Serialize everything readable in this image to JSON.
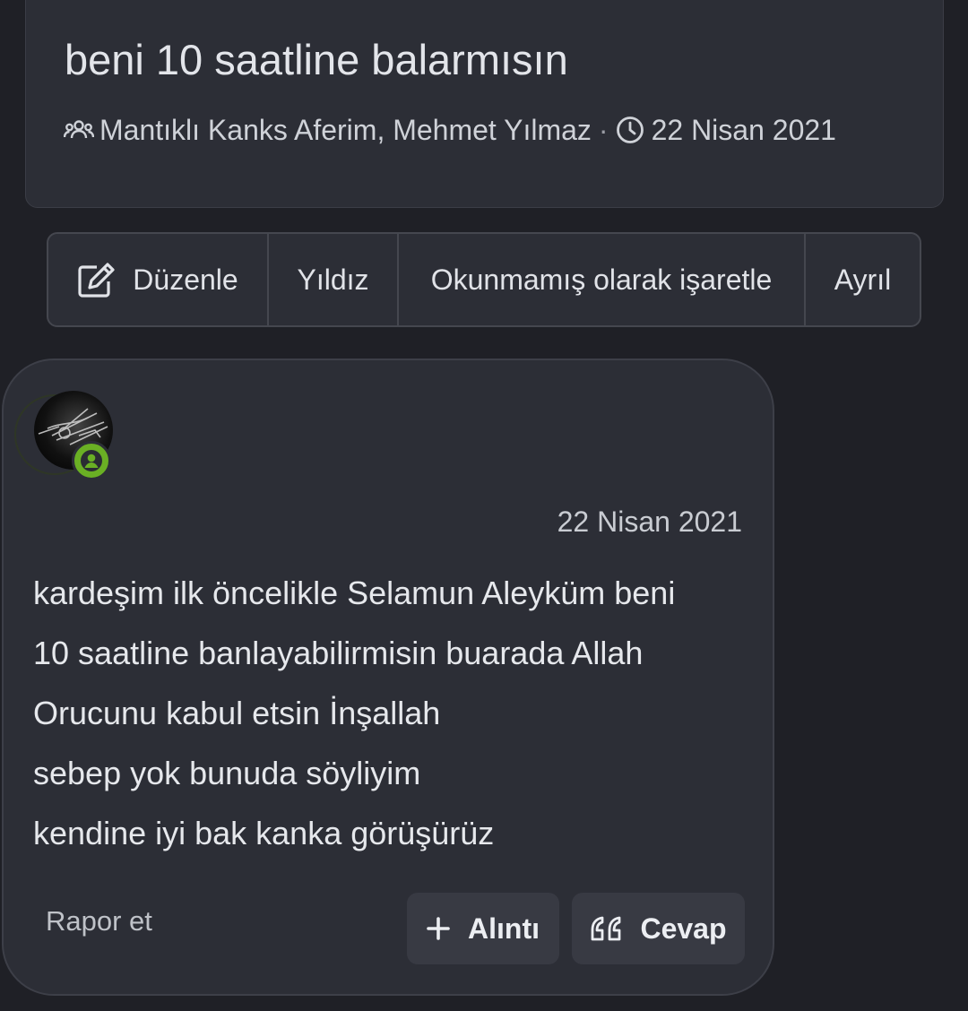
{
  "thread": {
    "title": "beni 10 saatline balarmısın",
    "participants": "Mantıklı Kanks Aferim, Mehmet Yılmaz",
    "separator": "·",
    "date": "22 Nisan 2021",
    "participants_icon": "users-icon",
    "date_icon": "clock-icon"
  },
  "actions": {
    "edit_label": "Düzenle",
    "edit_icon": "edit-icon",
    "star_label": "Yıldız",
    "unread_label": "Okunmamış olarak işaretle",
    "leave_label": "Ayrıl"
  },
  "post": {
    "date": "22 Nisan 2021",
    "lines": [
      "kardeşim ilk öncelikle Selamun Aleyküm beni",
      "10 saatline banlayabilirmisin buarada Allah",
      "Orucunu kabul etsin İnşallah",
      "sebep yok bunuda söyliyim",
      "kendine iyi bak kanka görüşürüz"
    ],
    "report_label": "Rapor et",
    "quote_label": "Alıntı",
    "quote_icon": "plus-icon",
    "reply_label": "Cevap",
    "reply_icon": "quote-mark-icon",
    "status_color": "#6ab024"
  },
  "colors": {
    "background": "#1f2026",
    "card": "#2c2e36",
    "button": "#383a43",
    "online": "#6ab024"
  }
}
